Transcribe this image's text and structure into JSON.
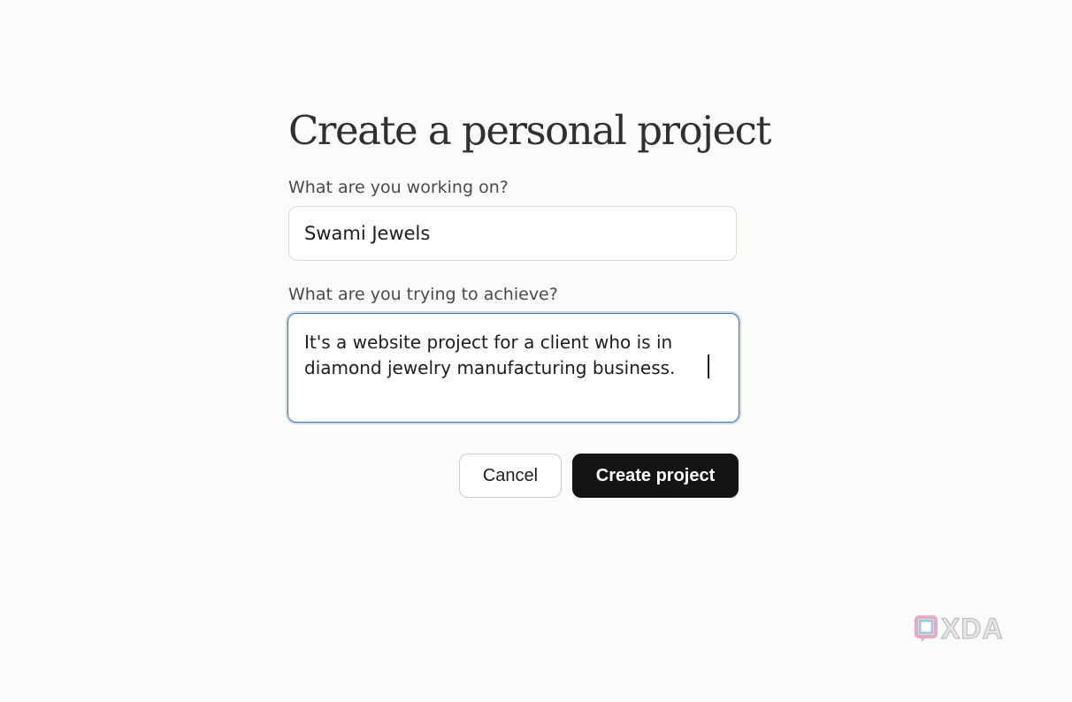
{
  "dialog": {
    "title": "Create a personal project",
    "working_on_label": "What are you working on?",
    "working_on_value": "Swami Jewels",
    "achieve_label": "What are you trying to achieve?",
    "achieve_value": "It's a website project for a client who is in diamond jewelry manufacturing business.",
    "cancel_label": "Cancel",
    "create_label": "Create project"
  },
  "watermark": {
    "text": "XDA",
    "icon": "xda-logo-icon"
  },
  "colors": {
    "background": "#fbfbf9",
    "focus_border": "#3b77b8",
    "primary_button": "#141413"
  }
}
